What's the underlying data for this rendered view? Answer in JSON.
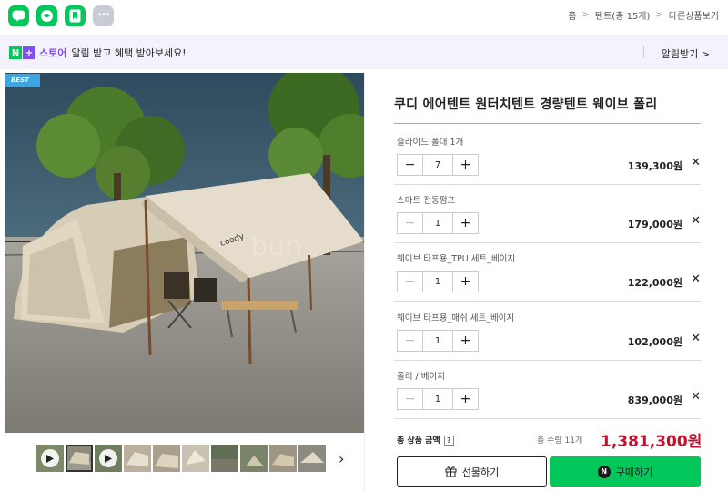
{
  "apps": [
    {
      "name": "blog",
      "label": "blog"
    },
    {
      "name": "cafe"
    },
    {
      "name": "bookmark"
    },
    {
      "name": "more",
      "label": "•••"
    }
  ],
  "breadcrumb": {
    "home": "홈",
    "sep": ">",
    "category": "텐트(총 15개)",
    "other": "다른상품보기"
  },
  "banner": {
    "n": "N",
    "plus": "+",
    "store": "스토어",
    "message": "알림 받고 혜택 받아보세요!",
    "alert": "알림받기 >"
  },
  "gallery": {
    "badge": "BEST",
    "next": "›"
  },
  "product": {
    "title": "쿠디 에어텐트 원터치텐트 경량텐트 웨이브 폴리"
  },
  "options": [
    {
      "name": "슬라이드 폴대 1개",
      "qty": "7",
      "price": "139,300원",
      "minus_enabled": true
    },
    {
      "name": "스마트 전동펌프",
      "qty": "1",
      "price": "179,000원",
      "minus_enabled": false
    },
    {
      "name": "웨이브 타프용_TPU 세트_베이지",
      "qty": "1",
      "price": "122,000원",
      "minus_enabled": false
    },
    {
      "name": "웨이브 타프용_매쉬 세트_베이지",
      "qty": "1",
      "price": "102,000원",
      "minus_enabled": false
    },
    {
      "name": "폴리 / 베이지",
      "qty": "1",
      "price": "839,000원",
      "minus_enabled": false
    }
  ],
  "controls": {
    "minus": "−",
    "plus": "+",
    "remove": "✕"
  },
  "total": {
    "label": "총 상품 금액",
    "help": "?",
    "count": "총 수량 11개",
    "price": "1,381,300원"
  },
  "actions": {
    "gift": "선물하기",
    "buy": "구매하기",
    "buy_mark": "N"
  },
  "colors": {
    "naver_green": "#03c75a",
    "price_red": "#c8102e",
    "store_purple": "#7f4ef2"
  }
}
